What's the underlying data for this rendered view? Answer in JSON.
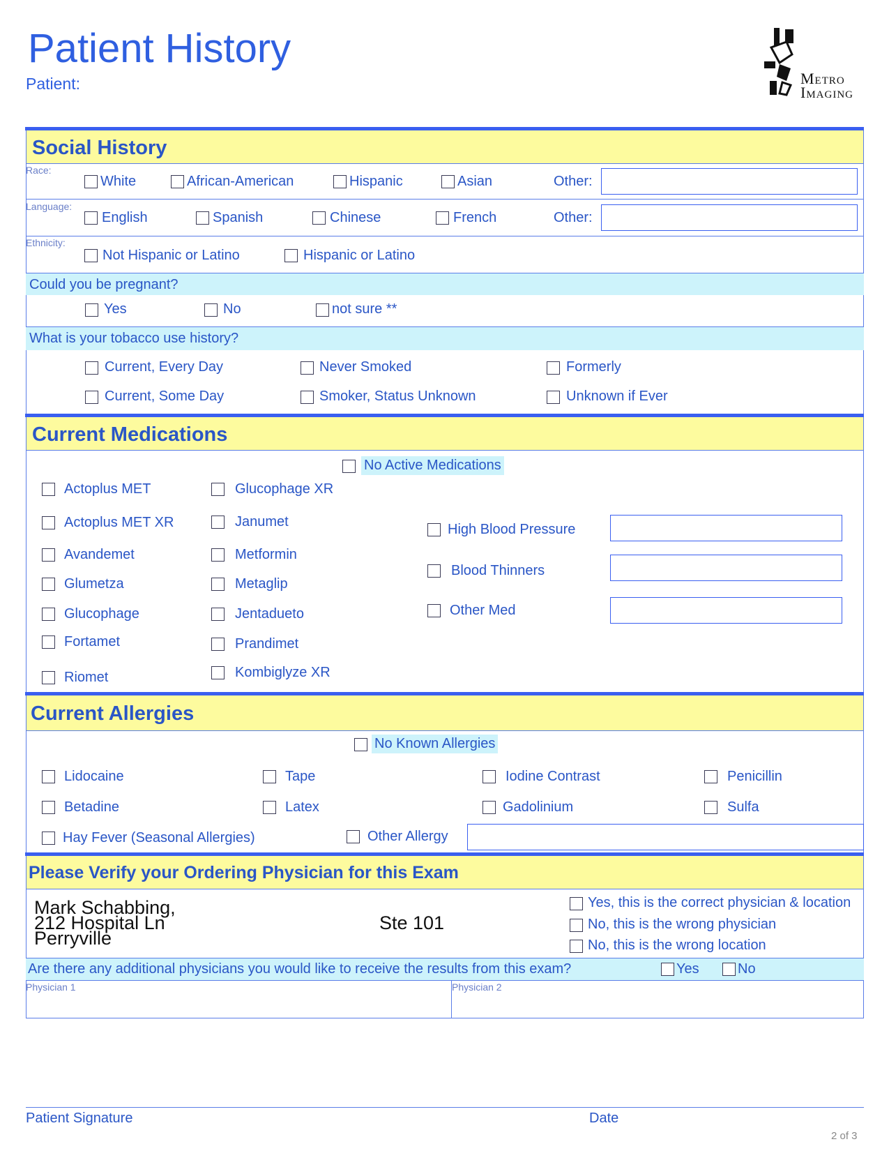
{
  "header": {
    "title": "Patient History",
    "patient_label": "Patient:",
    "logo_line1": "Metro",
    "logo_line2": "Imaging"
  },
  "social": {
    "heading": "Social History",
    "race_label": "Race:",
    "race_options": [
      "White",
      "African-American",
      "Hispanic",
      "Asian"
    ],
    "race_other": "Other:",
    "language_label": "Language:",
    "language_options": [
      "English",
      "Spanish",
      "Chinese",
      "French"
    ],
    "language_other": "Other:",
    "ethnicity_label": "Ethnicity:",
    "ethnicity_options": [
      "Not Hispanic or Latino",
      "Hispanic or Latino"
    ],
    "pregnant_q": "Could you be pregnant?",
    "pregnant_options": [
      "Yes",
      "No",
      "not sure **"
    ],
    "tobacco_q": "What is your tobacco use history?",
    "tobacco_options": [
      "Current, Every Day",
      "Never Smoked",
      "Formerly",
      "Current, Some Day",
      "Smoker, Status Unknown",
      "Unknown if Ever"
    ]
  },
  "meds": {
    "heading": "Current Medications",
    "none": "No Active Medications",
    "col1": [
      "Actoplus MET",
      "Actoplus MET XR",
      "Avandemet",
      "Glumetza",
      "Glucophage",
      "Fortamet",
      "Riomet"
    ],
    "col2": [
      "Glucophage XR",
      "Janumet",
      "Metformin",
      "Metaglip",
      "Jentadueto",
      "Prandimet",
      "Kombiglyze XR"
    ],
    "other": [
      "High Blood Pressure",
      "Blood Thinners",
      "Other Med"
    ]
  },
  "allergies": {
    "heading": "Current Allergies",
    "none": "No Known Allergies",
    "row1": [
      "Lidocaine",
      "Tape",
      "Iodine Contrast",
      "Penicillin"
    ],
    "row2": [
      "Betadine",
      "Latex",
      "Gadolinium",
      "Sulfa"
    ],
    "hay": "Hay Fever (Seasonal Allergies)",
    "other": "Other Allergy"
  },
  "physician": {
    "heading": "Please Verify your Ordering Physician for this Exam",
    "name": "Mark Schabbing,",
    "address": "212 Hospital Ln",
    "city": "Perryville",
    "suite": "Ste 101",
    "verify": [
      "Yes, this is the correct physician & location",
      "No, this is the wrong physician",
      "No, this is the wrong location"
    ],
    "additional_q": "Are there any additional physicians you would like to receive the results from this exam?",
    "additional_yes": "Yes",
    "additional_no": "No",
    "phys1": "Physician 1",
    "phys2": "Physician 2"
  },
  "footer": {
    "signature": "Patient Signature",
    "date": "Date",
    "page": "2 of 3"
  }
}
